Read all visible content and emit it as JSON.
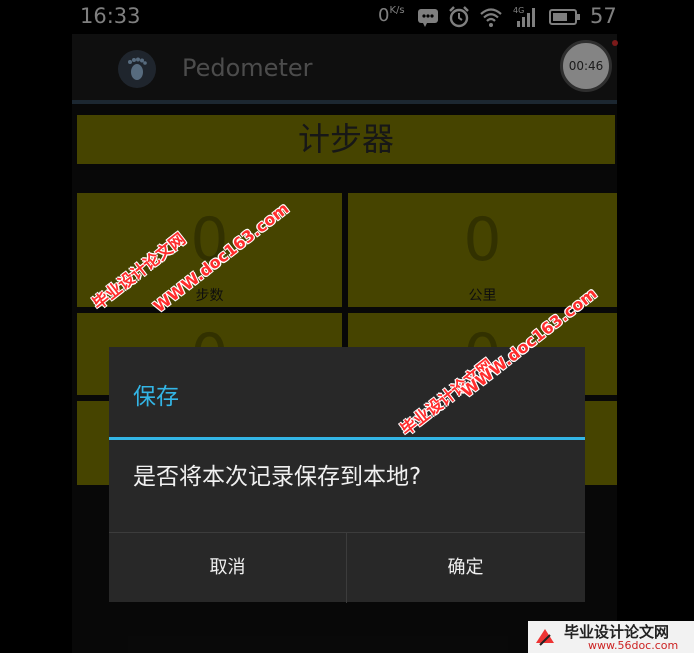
{
  "status_bar": {
    "time": "16:33",
    "net_speed": "0",
    "net_unit": "K/s",
    "battery": "57",
    "icons": [
      "message-icon",
      "alarm-icon",
      "wifi-icon",
      "signal-4g-icon",
      "battery-icon"
    ]
  },
  "app_bar": {
    "title": "Pedometer",
    "timer": "00:46"
  },
  "main": {
    "banner": "计步器",
    "cells": [
      {
        "value": "0",
        "label": "步数"
      },
      {
        "value": "0",
        "label": "公里"
      },
      {
        "value": "0",
        "label": ""
      },
      {
        "value": "0",
        "label": ""
      }
    ]
  },
  "dialog": {
    "title": "保存",
    "message": "是否将本次记录保存到本地?",
    "cancel_label": "取消",
    "confirm_label": "确定"
  },
  "watermark": {
    "site_name": "毕业设计论文网",
    "url": "WWW.doc163.com",
    "footer_site": "毕业设计论文网",
    "footer_url": "www.56doc.com"
  },
  "colors": {
    "accent": "#33b5e5",
    "tile": "#807d00",
    "dialog_bg": "#282828"
  }
}
